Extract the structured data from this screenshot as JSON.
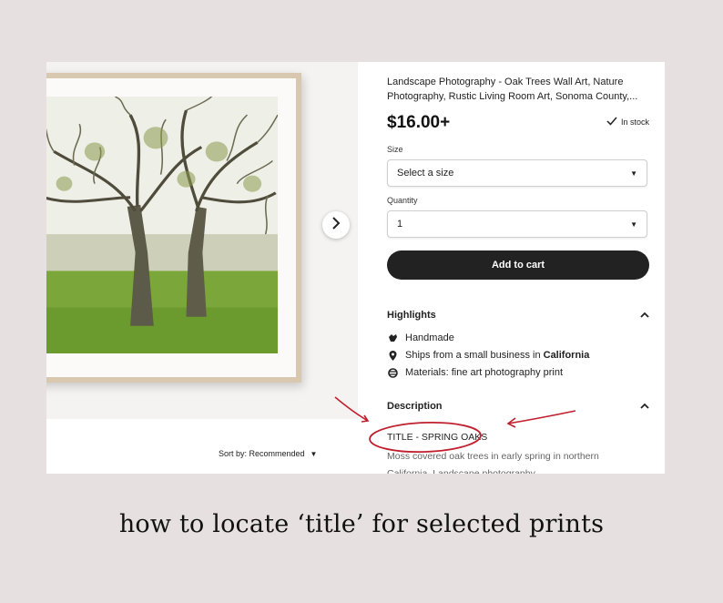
{
  "listing": {
    "title": "Landscape Photography - Oak Trees Wall Art, Nature Photography, Rustic Living Room Art, Sonoma County,...",
    "price": "$16.00+",
    "stock": "In stock",
    "size_label": "Size",
    "size_placeholder": "Select a size",
    "quantity_label": "Quantity",
    "quantity_value": "1",
    "add_to_cart": "Add to cart"
  },
  "highlights": {
    "heading": "Highlights",
    "items": [
      {
        "icon": "hand-icon",
        "text": "Handmade"
      },
      {
        "icon": "location-pin-icon",
        "text_prefix": "Ships from a small business in ",
        "text_bold": "California"
      },
      {
        "icon": "materials-icon",
        "text": "Materials: fine art photography print"
      }
    ]
  },
  "description": {
    "heading": "Description",
    "line1": "TITLE - SPRING OAKS",
    "line2": "Moss covered oak trees in early spring in northern California. Landscape photography."
  },
  "gallery": {
    "sort_label": "Sort by: Recommended",
    "next_icon": "chevron-right-icon"
  },
  "caption": "how to locate ‘title’ for selected prints",
  "colors": {
    "annotation": "#c0202e",
    "button": "#222222"
  }
}
